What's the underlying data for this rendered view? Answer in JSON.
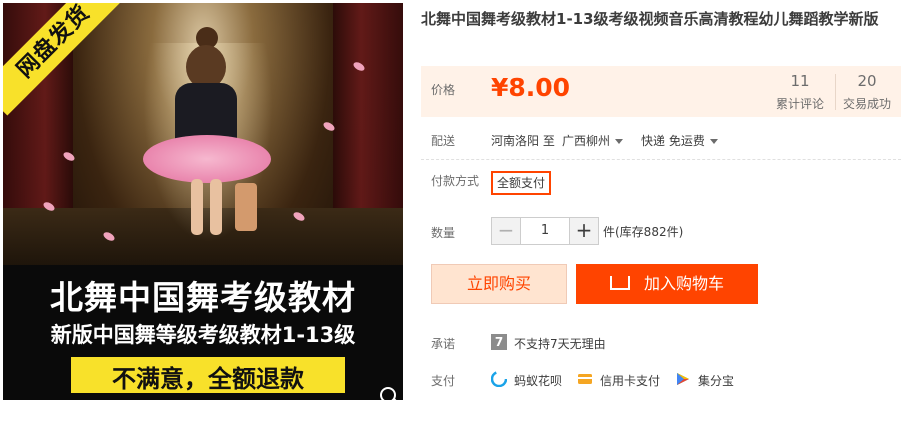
{
  "image": {
    "badge": "网盘发货",
    "title": "北舞中国舞考级教材",
    "subtitle": "新版中国舞等级考级教材1-13级",
    "slogan": "不满意，全额退款"
  },
  "product": {
    "title": "北舞中国舞考级教材1-13级考级视频音乐高清教程幼儿舞蹈教学新版"
  },
  "price": {
    "label": "价格",
    "value": "¥8.00",
    "reviews_count": "11",
    "reviews_label": "累计评论",
    "sales_count": "20",
    "sales_label": "交易成功"
  },
  "shipping": {
    "label": "配送",
    "from": "河南洛阳 至",
    "to": "广西柳州",
    "method": "快递 免运费"
  },
  "payment": {
    "label": "付款方式",
    "option": "全额支付"
  },
  "quantity": {
    "label": "数量",
    "minus": "−",
    "value": "1",
    "plus": "+",
    "stock": "件(库存882件)"
  },
  "actions": {
    "buy_now": "立即购买",
    "add_to_cart": "加入购物车"
  },
  "promise": {
    "label": "承诺",
    "icon_text": "7",
    "text": "不支持7天无理由"
  },
  "pay_methods": {
    "label": "支付",
    "items": [
      "蚂蚁花呗",
      "信用卡支付",
      "集分宝"
    ]
  },
  "colors": {
    "accent": "#ff4400",
    "price_bg": "#fff2e8",
    "buy_bg": "#ffe4d0"
  }
}
